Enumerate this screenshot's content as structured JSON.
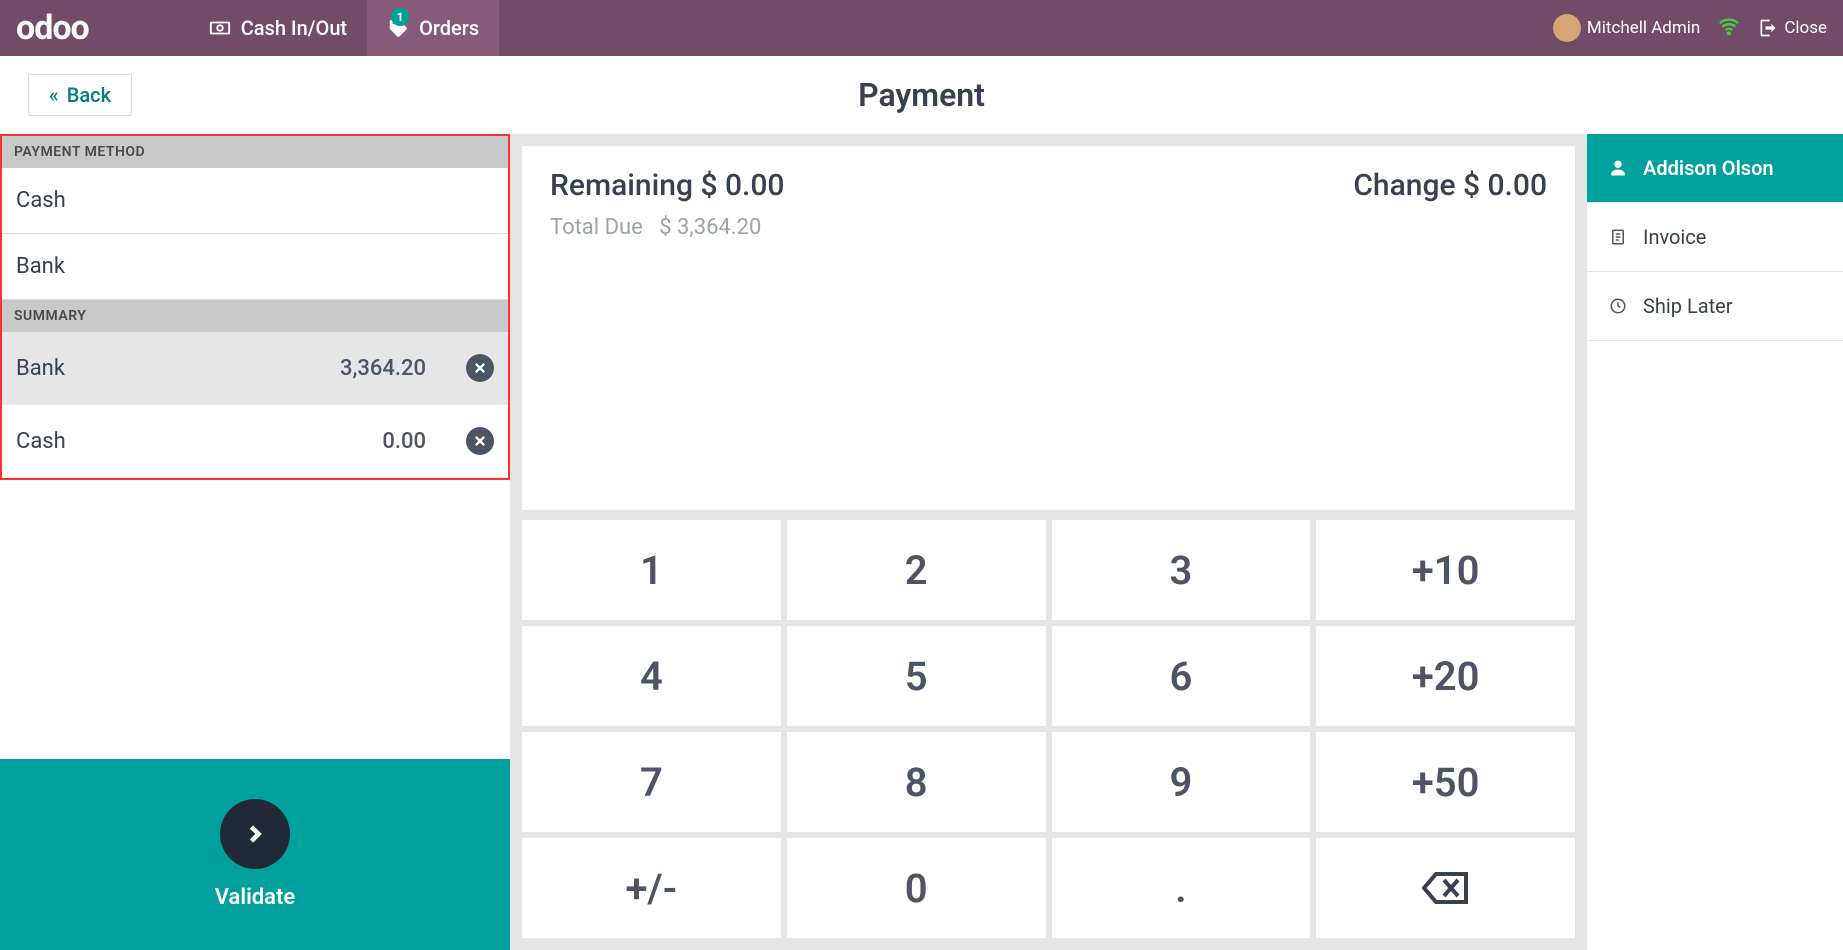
{
  "header": {
    "logo": "odoo",
    "nav": {
      "cash": "Cash In/Out",
      "orders": "Orders",
      "orders_badge": "1"
    },
    "user": "Mitchell Admin",
    "close": "Close"
  },
  "subheader": {
    "back": "Back",
    "title": "Payment"
  },
  "payment_method": {
    "header": "PAYMENT METHOD",
    "items": [
      "Cash",
      "Bank"
    ]
  },
  "summary": {
    "header": "SUMMARY",
    "rows": [
      {
        "label": "Bank",
        "amount": "3,364.20"
      },
      {
        "label": "Cash",
        "amount": "0.00"
      }
    ]
  },
  "validate": "Validate",
  "info": {
    "remaining_label": "Remaining",
    "remaining_value": "$ 0.00",
    "change_label": "Change",
    "change_value": "$ 0.00",
    "total_due_label": "Total Due",
    "total_due_value": "$ 3,364.20"
  },
  "numpad": {
    "k1": "1",
    "k2": "2",
    "k3": "3",
    "k_p10": "+10",
    "k4": "4",
    "k5": "5",
    "k6": "6",
    "k_p20": "+20",
    "k7": "7",
    "k8": "8",
    "k9": "9",
    "k_p50": "+50",
    "k_sign": "+/-",
    "k0": "0",
    "k_dot": "."
  },
  "right": {
    "customer": "Addison Olson",
    "invoice": "Invoice",
    "ship_later": "Ship Later"
  }
}
